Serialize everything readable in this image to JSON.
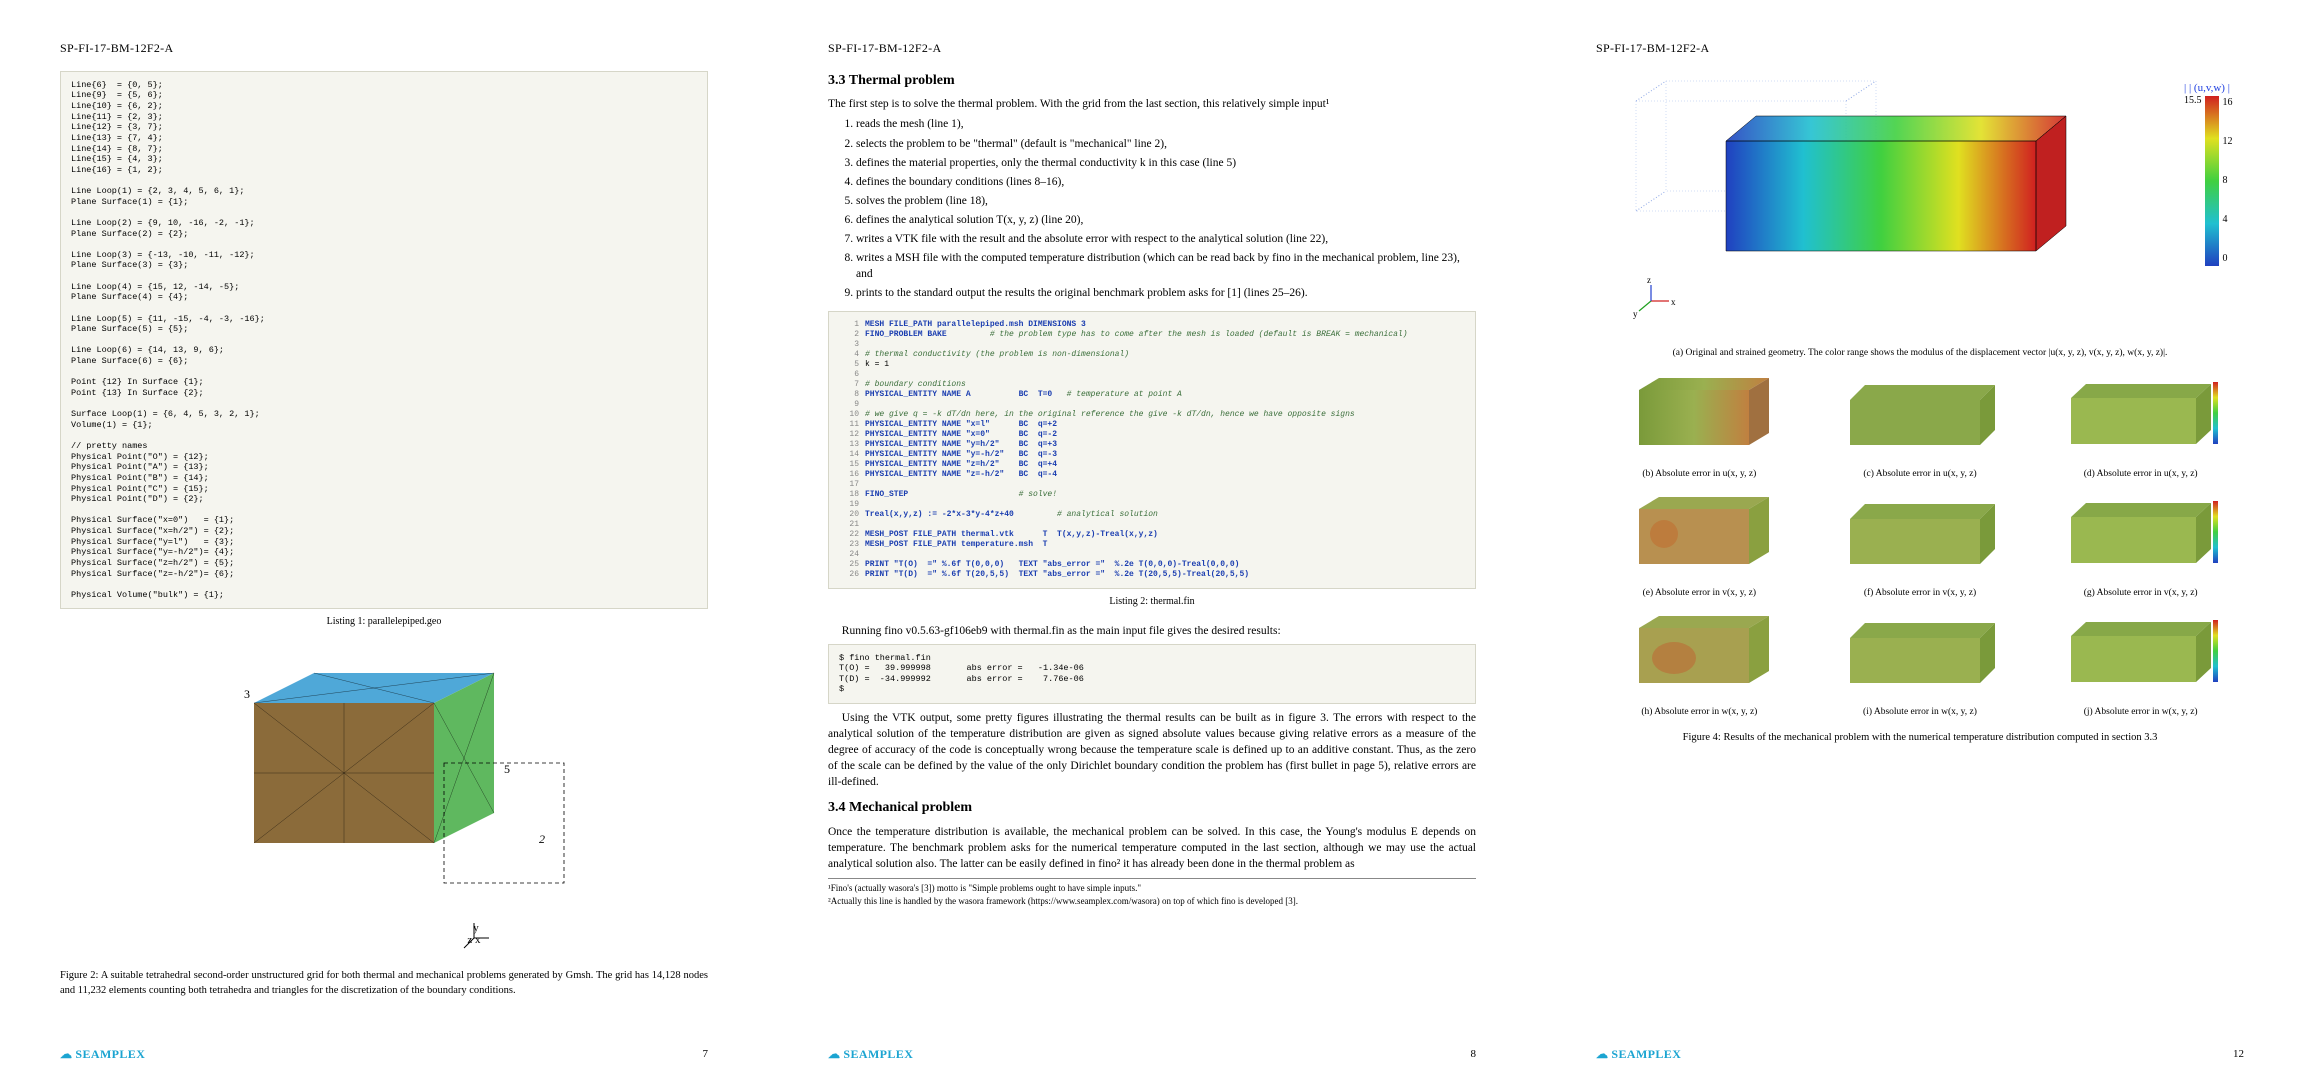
{
  "header_id": "SP-FI-17-BM-12F2-A",
  "pages": {
    "p7": "7",
    "p8": "8",
    "p12": "12"
  },
  "logo_text": "SEAMPLEX",
  "listing1": {
    "caption": "Listing 1: parallelepiped.geo",
    "code": "Line{6}  = {0, 5};\nLine{9}  = {5, 6};\nLine{10} = {6, 2};\nLine{11} = {2, 3};\nLine{12} = {3, 7};\nLine{13} = {7, 4};\nLine{14} = {8, 7};\nLine{15} = {4, 3};\nLine{16} = {1, 2};\n\nLine Loop(1) = {2, 3, 4, 5, 6, 1};\nPlane Surface(1) = {1};\n\nLine Loop(2) = {9, 10, -16, -2, -1};\nPlane Surface(2) = {2};\n\nLine Loop(3) = {-13, -10, -11, -12};\nPlane Surface(3) = {3};\n\nLine Loop(4) = {15, 12, -14, -5};\nPlane Surface(4) = {4};\n\nLine Loop(5) = {11, -15, -4, -3, -16};\nPlane Surface(5) = {5};\n\nLine Loop(6) = {14, 13, 9, 6};\nPlane Surface(6) = {6};\n\nPoint {12} In Surface {1};\nPoint {13} In Surface {2};\n\nSurface Loop(1) = {6, 4, 5, 3, 2, 1};\nVolume(1) = {1};\n\n// pretty names\nPhysical Point(\"O\") = {12};\nPhysical Point(\"A\") = {13};\nPhysical Point(\"B\") = {14};\nPhysical Point(\"C\") = {15};\nPhysical Point(\"D\") = {2};\n\nPhysical Surface(\"x=0\")   = {1};\nPhysical Surface(\"x=h/2\") = {2};\nPhysical Surface(\"y=l\")   = {3};\nPhysical Surface(\"y=-h/2\")= {4};\nPhysical Surface(\"z=h/2\") = {5};\nPhysical Surface(\"z=-h/2\")= {6};\n\nPhysical Volume(\"bulk\") = {1};"
  },
  "fig2": {
    "caption": "Figure 2: A suitable tetrahedral second-order unstructured grid for both thermal and mechanical problems generated by Gmsh. The grid has 14,128 nodes and 11,232 elements counting both tetrahedra and triangles for the discretization of the boundary conditions."
  },
  "sec33": {
    "title": "3.3   Thermal problem",
    "intro": "The first step is to solve the thermal problem. With the grid from the last section, this relatively simple input¹",
    "steps": [
      "reads the mesh (line 1),",
      "selects the problem to be \"thermal\" (default is \"mechanical\" line 2),",
      "defines the material properties, only the thermal conductivity k in this case (line 5)",
      "defines the boundary conditions (lines 8–16),",
      "solves the problem (line 18),",
      "defines the analytical solution T(x, y, z) (line 20),",
      "writes a VTK file with the result and the absolute error with respect to the analytical solution (line 22),",
      "writes a MSH file with the computed temperature distribution (which can be read back by fino in the mechanical problem, line 23), and",
      "prints to the standard output the results the original benchmark problem asks for [1] (lines 25–26)."
    ]
  },
  "listing2": {
    "caption": "Listing 2: thermal.fin",
    "lines": [
      {
        "n": "1",
        "t": "MESH FILE_PATH parallelepiped.msh DIMENSIONS 3",
        "c": "blue"
      },
      {
        "n": "2",
        "t": "FINO_PROBLEM BAKE         # the problem type has to come after the mesh is loaded (default is BREAK = mechanical)",
        "c": "mix"
      },
      {
        "n": "3",
        "t": "",
        "c": ""
      },
      {
        "n": "4",
        "t": "# thermal conductivity (the problem is non-dimensional)",
        "c": "green"
      },
      {
        "n": "5",
        "t": "k = 1",
        "c": ""
      },
      {
        "n": "6",
        "t": "",
        "c": ""
      },
      {
        "n": "7",
        "t": "# boundary conditions",
        "c": "green"
      },
      {
        "n": "8",
        "t": "PHYSICAL_ENTITY NAME A          BC  T=0   # temperature at point A",
        "c": "mix"
      },
      {
        "n": "9",
        "t": "",
        "c": ""
      },
      {
        "n": "10",
        "t": "# we give q = -k dT/dn here, in the original reference the give -k dT/dn, hence we have opposite signs",
        "c": "green"
      },
      {
        "n": "11",
        "t": "PHYSICAL_ENTITY NAME \"x=l\"      BC  q=+2",
        "c": "blue"
      },
      {
        "n": "12",
        "t": "PHYSICAL_ENTITY NAME \"x=0\"      BC  q=-2",
        "c": "blue"
      },
      {
        "n": "13",
        "t": "PHYSICAL_ENTITY NAME \"y=h/2\"    BC  q=+3",
        "c": "blue"
      },
      {
        "n": "14",
        "t": "PHYSICAL_ENTITY NAME \"y=-h/2\"   BC  q=-3",
        "c": "blue"
      },
      {
        "n": "15",
        "t": "PHYSICAL_ENTITY NAME \"z=h/2\"    BC  q=+4",
        "c": "blue"
      },
      {
        "n": "16",
        "t": "PHYSICAL_ENTITY NAME \"z=-h/2\"   BC  q=-4",
        "c": "blue"
      },
      {
        "n": "17",
        "t": "",
        "c": ""
      },
      {
        "n": "18",
        "t": "FINO_STEP                       # solve!",
        "c": "mix"
      },
      {
        "n": "19",
        "t": "",
        "c": ""
      },
      {
        "n": "20",
        "t": "Treal(x,y,z) := -2*x-3*y-4*z+40         # analytical solution",
        "c": "mix"
      },
      {
        "n": "21",
        "t": "",
        "c": ""
      },
      {
        "n": "22",
        "t": "MESH_POST FILE_PATH thermal.vtk      T  T(x,y,z)-Treal(x,y,z)",
        "c": "blue"
      },
      {
        "n": "23",
        "t": "MESH_POST FILE_PATH temperature.msh  T",
        "c": "blue"
      },
      {
        "n": "24",
        "t": "",
        "c": ""
      },
      {
        "n": "25",
        "t": "PRINT \"T(O)  =\" %.6f T(0,0,0)   TEXT \"abs_error =\"  %.2e T(0,0,0)-Treal(0,0,0)",
        "c": "blue"
      },
      {
        "n": "26",
        "t": "PRINT \"T(D)  =\" %.6f T(20,5,5)  TEXT \"abs_error =\"  %.2e T(20,5,5)-Treal(20,5,5)",
        "c": "blue"
      }
    ]
  },
  "run_line": "Running fino v0.5.63-gf106eb9 with thermal.fin as the main input file gives the desired results:",
  "output_block": "$ fino thermal.fin\nT(O) =   39.999998       abs error =   -1.34e-06\nT(D) =  -34.999992       abs error =    7.76e-06\n$",
  "para_after_output": "Using the VTK output, some pretty figures illustrating the thermal results can be built as in figure 3. The errors with respect to the analytical solution of the temperature distribution are given as signed absolute values because giving relative errors as a measure of the degree of accuracy of the code is conceptually wrong because the temperature scale is defined up to an additive constant. Thus, as the zero of the scale can be defined by the value of the only Dirichlet boundary condition the problem has (first bullet in page 5), relative errors are ill-defined.",
  "sec34": {
    "title": "3.4   Mechanical problem",
    "para": "Once the temperature distribution is available, the mechanical problem can be solved. In this case, the Young's modulus E depends on temperature. The benchmark problem asks for the numerical temperature computed in the last section, although we may use the actual analytical solution also. The latter can be easily defined in fino² it has already been done in the thermal problem as"
  },
  "footnotes": {
    "fn1": "¹Fino's (actually wasora's [3]) motto is \"Simple problems ought to have simple inputs.\"",
    "fn2": "²Actually this line is handled by the wasora framework (https://www.seamplex.com/wasora) on top of which fino is developed [3]."
  },
  "fig4": {
    "big_caption": "(a) Original and strained geometry. The color range shows the modulus of the displacement vector |u(x, y, z), v(x, y, z), w(x, y, z)|.",
    "colorbar_label": "| | (u,v,w) |",
    "colorbar_ticks": [
      "16",
      "12",
      "8",
      "4",
      "0"
    ],
    "colorbar_peak": "15.5",
    "subs": [
      "(b) Absolute error in u(x, y, z)",
      "(c) Absolute error in u(x, y, z)",
      "(d) Absolute error in u(x, y, z)",
      "(e) Absolute error in v(x, y, z)",
      "(f) Absolute error in v(x, y, z)",
      "(g) Absolute error in v(x, y, z)",
      "(h) Absolute error in w(x, y, z)",
      "(i) Absolute error in w(x, y, z)",
      "(j) Absolute error in w(x, y, z)"
    ],
    "main_caption": "Figure 4: Results of the mechanical problem with the numerical temperature distribution computed in section 3.3"
  }
}
